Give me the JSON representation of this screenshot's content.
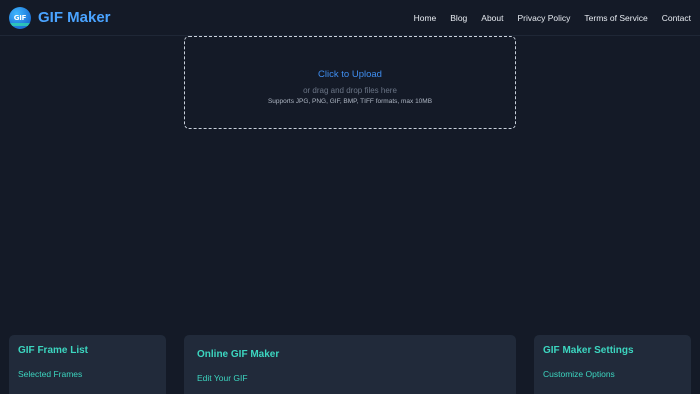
{
  "brand": {
    "logo_text": "GIF",
    "name": "GIF Maker"
  },
  "nav": {
    "links": [
      "Home",
      "Blog",
      "About",
      "Privacy Policy",
      "Terms of Service",
      "Contact"
    ]
  },
  "upload": {
    "title": "Click to Upload",
    "subtitle": "or drag and drop files here",
    "formats": "Supports JPG, PNG, GIF, BMP, TIFF formats, max 10MB"
  },
  "panels": {
    "frame_list": {
      "title": "GIF Frame List",
      "subtitle": "Selected Frames"
    },
    "editor": {
      "title": "Online GIF Maker",
      "subtitle": "Edit Your GIF"
    },
    "settings": {
      "title": "GIF Maker Settings",
      "subtitle": "Customize Options"
    }
  },
  "colors": {
    "background": "#141a27",
    "brand_accent": "#4aa3ff",
    "upload_link": "#3f8ef0",
    "panel_heading": "#3cd6c0",
    "panel_background": "#212a3a"
  }
}
